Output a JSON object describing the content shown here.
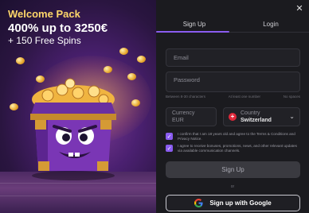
{
  "promo": {
    "title": "Welcome Pack",
    "amount": "400% up to 3250€",
    "spins": "+ 150 Free Spins"
  },
  "tabs": [
    {
      "label": "Sign Up",
      "active": true
    },
    {
      "label": "Login",
      "active": false
    }
  ],
  "form": {
    "email_placeholder": "Email",
    "password_placeholder": "Password",
    "password_hints": [
      "Between 8-30 characters",
      "At least one number",
      "No spaces"
    ],
    "currency_label": "Currency",
    "currency_value": "EUR",
    "country_label": "Country",
    "country_value": "Switzerland",
    "country_flag_icon": "swiss-flag-icon",
    "terms_text": "I confirm that I am 18 years old and agree to the Terms & Conditions and Privacy Notice.",
    "terms_checked": true,
    "promo_text": "I agree to receive bonuses, promotions, news, and other relevant updates via available communication channels.",
    "promo_checked": true,
    "submit_label": "Sign Up",
    "or_label": "or",
    "google_label": "Sign up with Google"
  },
  "colors": {
    "accent": "#8a5cf0",
    "promo_title": "#ffd76a",
    "background": "#1b1b1f"
  }
}
